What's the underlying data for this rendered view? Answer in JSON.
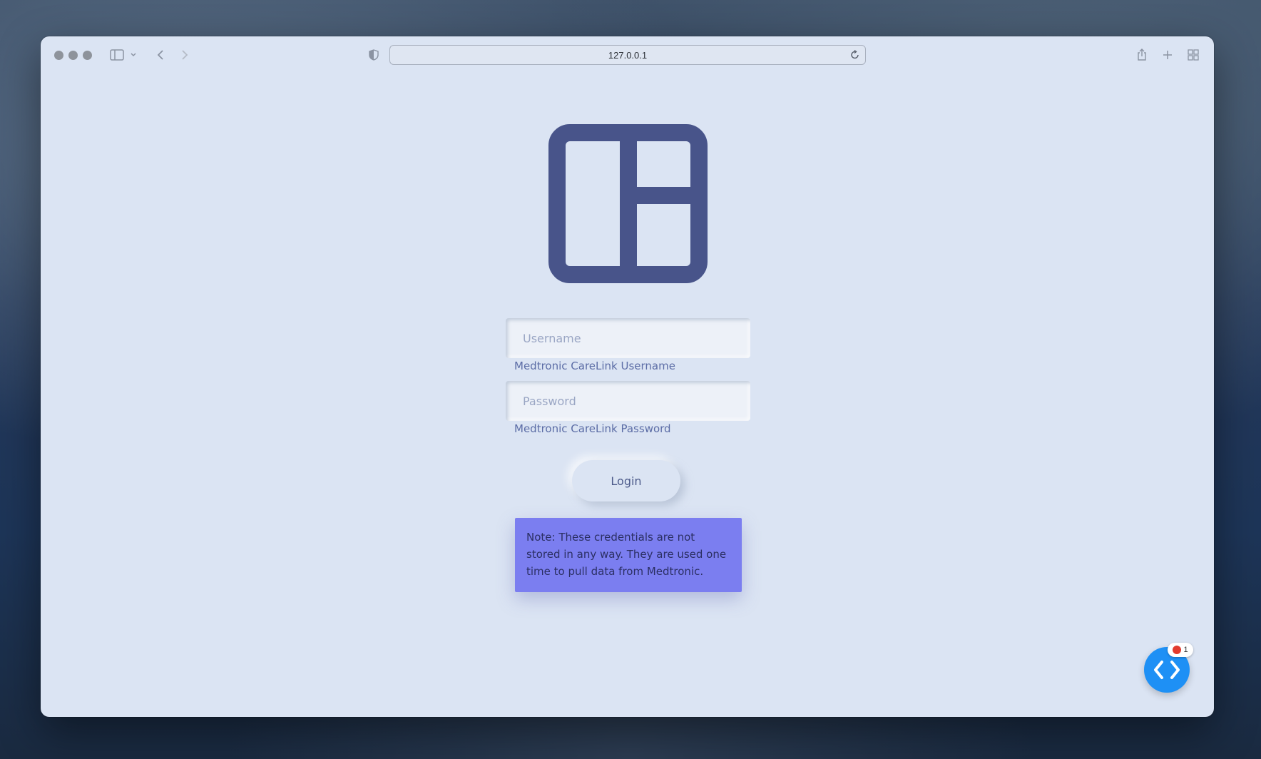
{
  "browser": {
    "url": "127.0.0.1"
  },
  "form": {
    "username_placeholder": "Username",
    "username_hint": "Medtronic CareLink Username",
    "password_placeholder": "Password",
    "password_hint": "Medtronic CareLink Password",
    "login_label": "Login"
  },
  "note": {
    "text": "Note: These credentials are not stored in any way. They are used one time to pull data from Medtronic."
  },
  "devtools_badge": {
    "count": "1"
  },
  "colors": {
    "page_background": "#dbe4f3",
    "logo": "#48548a",
    "note_background": "#7b7ef0",
    "fab": "#1e90f5"
  },
  "icons": {
    "logo": "layout-panels-icon",
    "fab": "code-brackets-icon"
  }
}
